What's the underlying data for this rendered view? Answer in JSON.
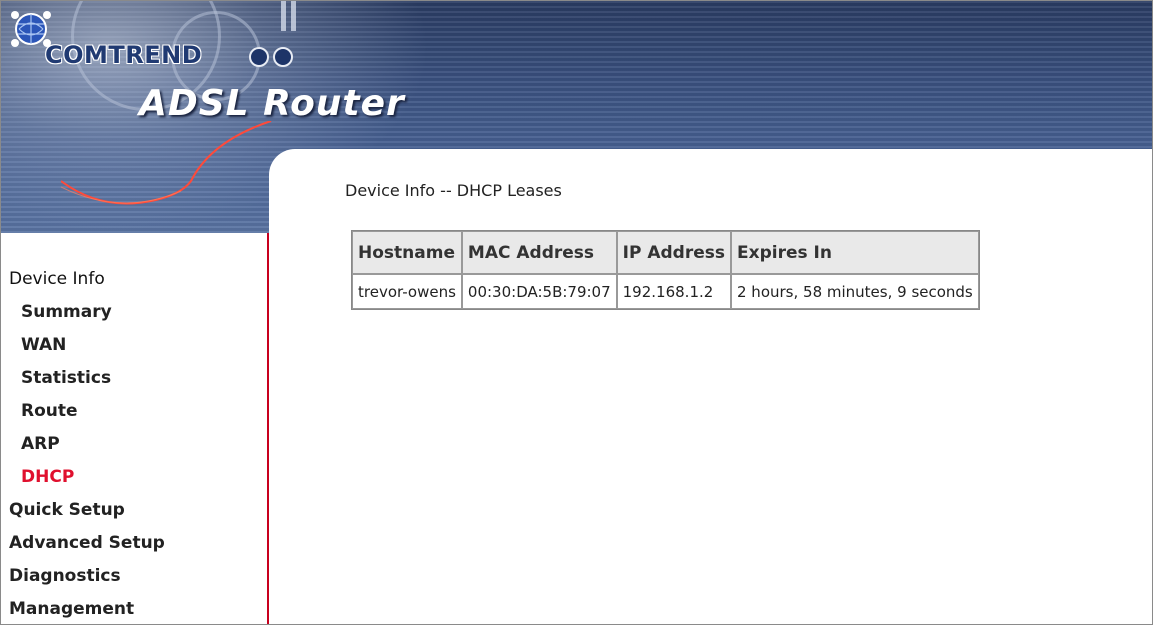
{
  "header": {
    "brand": "COMTREND",
    "product": "ADSL Router",
    "logo_icon": "globe-flower-icon",
    "colors": {
      "banner": "#3a5180",
      "accent": "#c8001e",
      "active_nav": "#e0102e"
    }
  },
  "sidebar": {
    "items": [
      {
        "label": "Device Info",
        "level": 0
      },
      {
        "label": "Summary",
        "level": 1
      },
      {
        "label": "WAN",
        "level": 1
      },
      {
        "label": "Statistics",
        "level": 1
      },
      {
        "label": "Route",
        "level": 1
      },
      {
        "label": "ARP",
        "level": 1
      },
      {
        "label": "DHCP",
        "level": 1,
        "active": true
      },
      {
        "label": "Quick Setup",
        "level": 0
      },
      {
        "label": "Advanced Setup",
        "level": 0
      },
      {
        "label": "Diagnostics",
        "level": 0
      },
      {
        "label": "Management",
        "level": 0
      }
    ]
  },
  "main": {
    "title": "Device Info -- DHCP Leases",
    "table": {
      "headers": [
        "Hostname",
        "MAC Address",
        "IP Address",
        "Expires In"
      ],
      "rows": [
        [
          "trevor-owens",
          "00:30:DA:5B:79:07",
          "192.168.1.2",
          "2 hours, 58 minutes, 9 seconds"
        ]
      ]
    }
  }
}
